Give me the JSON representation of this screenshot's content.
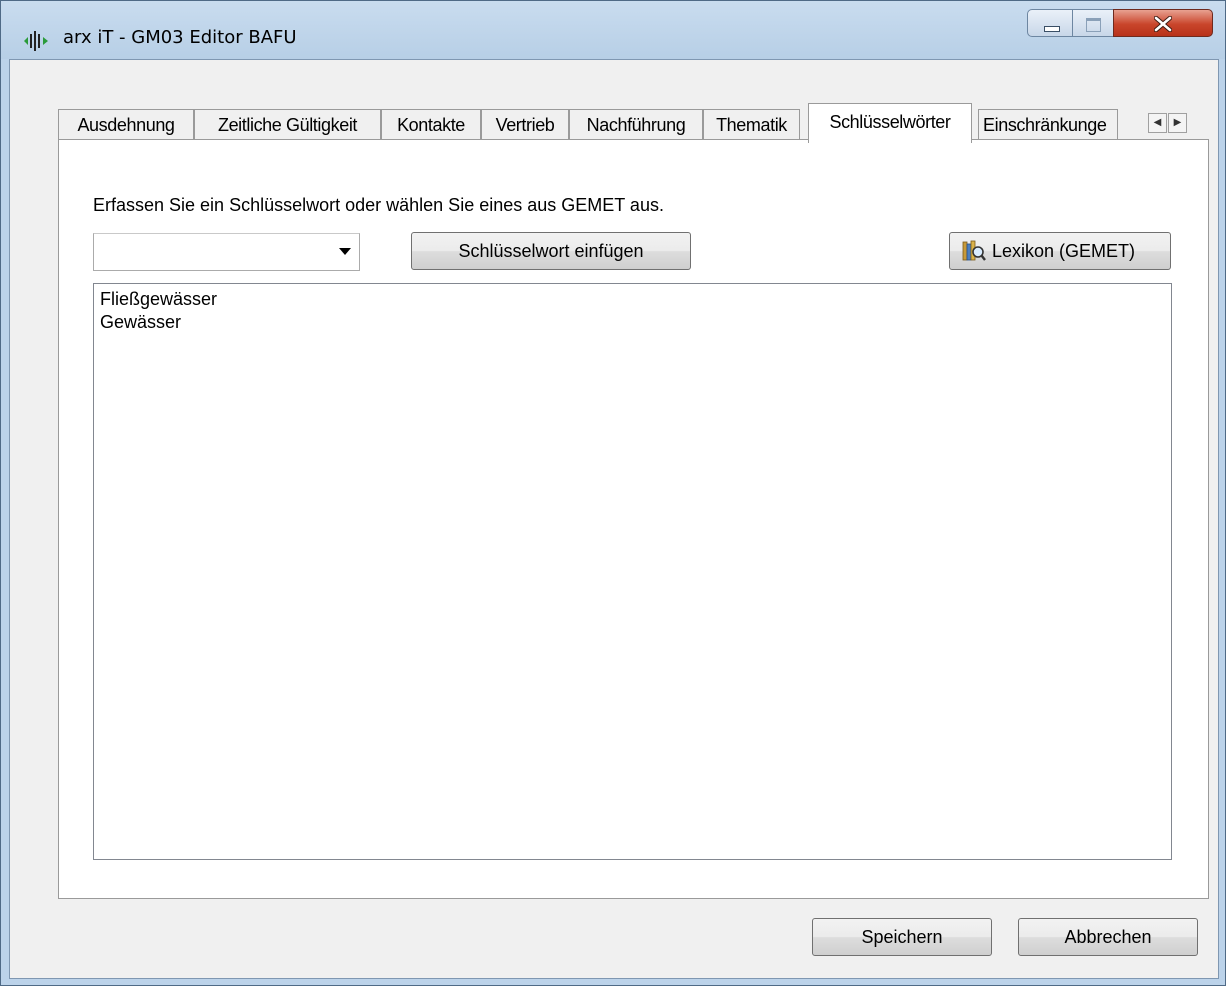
{
  "window": {
    "title": "arx iT - GM03 Editor BAFU"
  },
  "tabs": [
    {
      "label": "Ausdehnung"
    },
    {
      "label": "Zeitliche Gültigkeit"
    },
    {
      "label": "Kontakte"
    },
    {
      "label": "Vertrieb"
    },
    {
      "label": "Nachführung"
    },
    {
      "label": "Thematik"
    },
    {
      "label": "Schlüsselwörter"
    },
    {
      "label": "Einschränkunge"
    }
  ],
  "active_tab": "Schlüsselwörter",
  "keywords_panel": {
    "instruction": "Erfassen Sie ein Schlüsselwort oder wählen Sie eines aus GEMET aus.",
    "combo_value": "",
    "insert_button": "Schlüsselwort einfügen",
    "lexikon_button": "Lexikon (GEMET)",
    "keywords": [
      "Fließgewässer",
      "Gewässer"
    ]
  },
  "footer": {
    "save_button": "Speichern",
    "cancel_button": "Abbrechen"
  },
  "icons": {
    "app": "audio-waveform-icon",
    "lexikon": "dictionary-search-icon",
    "tab_scroll_left": "triangle-left-icon",
    "tab_scroll_right": "triangle-right-icon"
  }
}
